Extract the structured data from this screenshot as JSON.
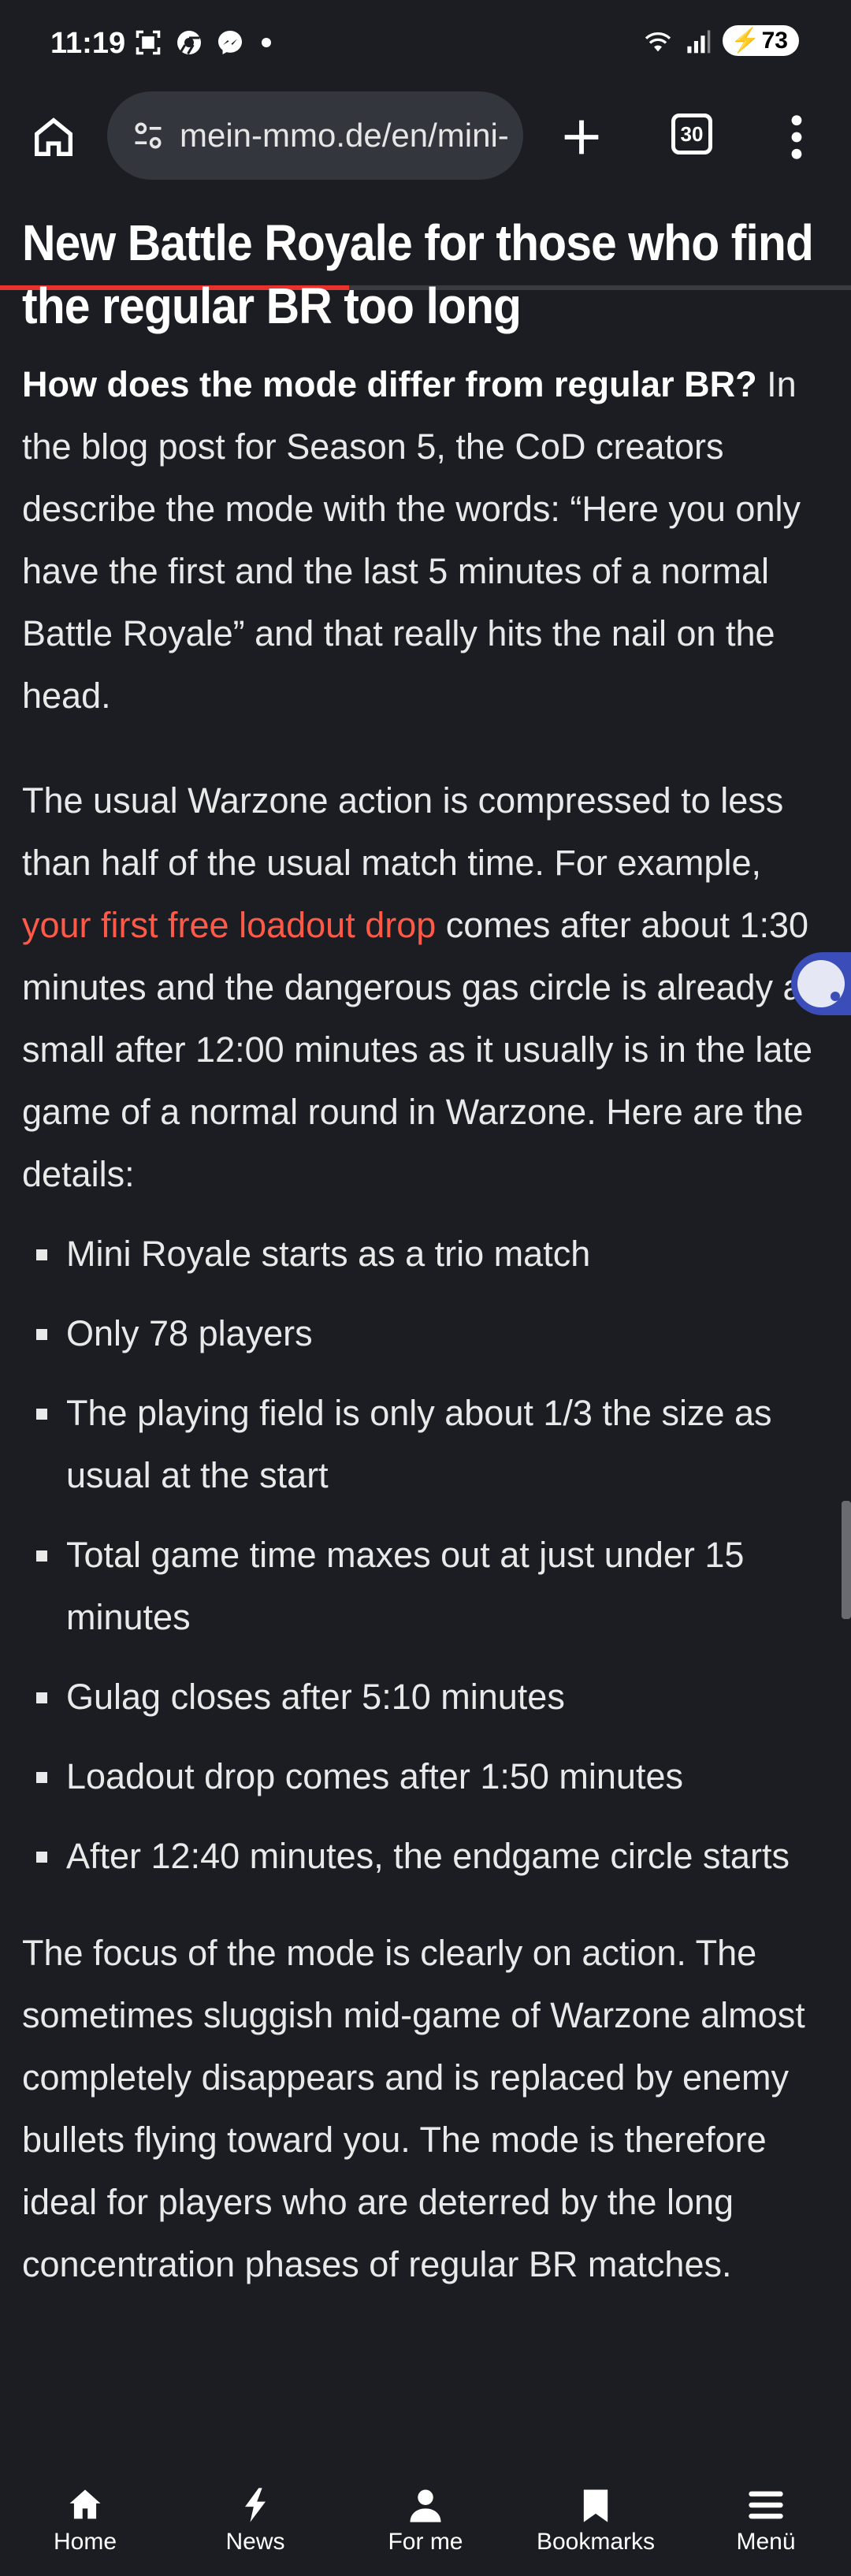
{
  "status_bar": {
    "time": "11:19",
    "battery": "73",
    "icons": [
      "screenshot-icon",
      "chrome-icon",
      "messenger-icon",
      "wifi-icon",
      "signal-icon",
      "battery-icon"
    ]
  },
  "browser": {
    "url": "mein-mmo.de/en/mini-royale",
    "tab_count": "30",
    "load_progress": 0.41
  },
  "article": {
    "heading": "New Battle Royale for those who find the regular BR too long",
    "p1_bold": "How does the mode differ from regular BR?",
    "p1_text": " In the blog post for Season 5, the CoD creators describe the mode with the words: “Here you only have the first and the last 5 minutes of a normal Battle Royale” and that really hits the nail on the head.",
    "p2_before": "The usual Warzone action is compressed to less than half of the usual match time. For example, ",
    "p2_link": "your first free loadout drop",
    "p2_after": " comes after about 1:30 minutes and the dangerous gas circle is already as small after 12:00 minutes as it usually is in the late game of a normal round in Warzone. Here are the details:",
    "details": [
      "Mini Royale starts as a trio match",
      "Only 78 players",
      "The playing field is only about 1/3 the size as usual at the start",
      "Total game time maxes out at just under 15 minutes",
      "Gulag closes after 5:10 minutes",
      "Loadout drop comes after 1:50 minutes",
      "After 12:40 minutes, the endgame circle starts"
    ],
    "p3": "The focus of the mode is clearly on action. The sometimes sluggish mid-game of Warzone almost completely disappears and is replaced by enemy bullets flying toward you. The mode is therefore ideal for players who are deterred by the long concentration phases of regular BR matches."
  },
  "bottom_nav": {
    "items": [
      {
        "label": "Home",
        "icon": "home-icon"
      },
      {
        "label": "News",
        "icon": "bolt-icon"
      },
      {
        "label": "For me",
        "icon": "person-icon"
      },
      {
        "label": "Bookmarks",
        "icon": "bookmark-icon"
      },
      {
        "label": "Menü",
        "icon": "hamburger-icon"
      }
    ]
  },
  "colors": {
    "background": "#1c1d22",
    "link": "#ff5a48",
    "progress": "#e8322e"
  }
}
